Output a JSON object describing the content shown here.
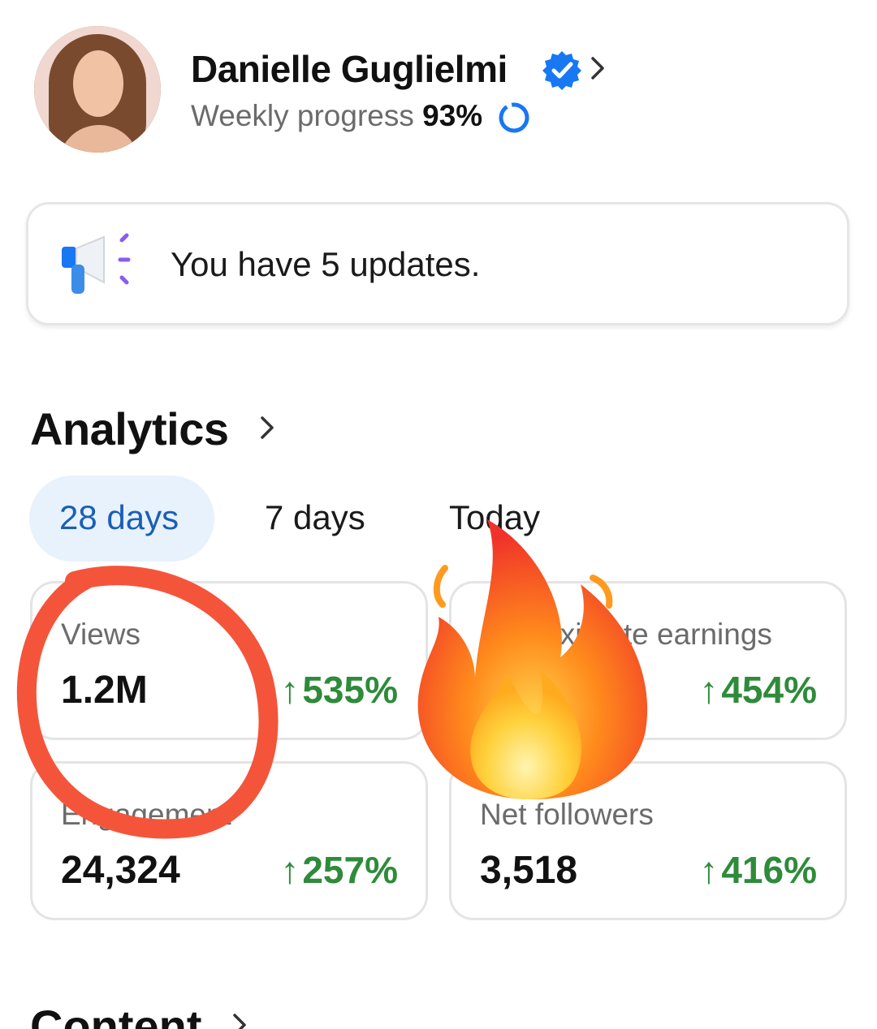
{
  "profile": {
    "name": "Danielle Guglielmi",
    "weekly_label": "Weekly progress",
    "weekly_value": "93%",
    "verified_color": "#1877f2"
  },
  "updates": {
    "text": "You have 5 updates."
  },
  "analytics": {
    "title": "Analytics",
    "tabs": [
      {
        "label": "28 days",
        "active": true
      },
      {
        "label": "7 days",
        "active": false
      },
      {
        "label": "Today",
        "active": false
      }
    ],
    "metrics": [
      {
        "label": "Views",
        "value": "1.2M",
        "change": "535%"
      },
      {
        "label": "Approximate earnings",
        "value": "",
        "change": "454%"
      },
      {
        "label": "Engagement",
        "value": "24,324",
        "change": "257%"
      },
      {
        "label": "Net followers",
        "value": "3,518",
        "change": "416%"
      }
    ]
  },
  "content": {
    "title": "Content"
  },
  "colors": {
    "accent": "#1a5fb4",
    "positive": "#2e8b3a",
    "annotation_circle": "#f4553a"
  }
}
